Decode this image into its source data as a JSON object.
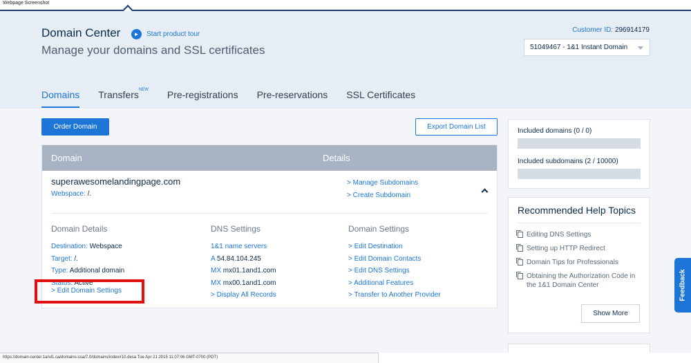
{
  "caption": "Webpage Screenshot",
  "header": {
    "title": "Domain Center",
    "tour_label": "Start product tour",
    "subtitle": "Manage your domains and SSL certificates",
    "customer_id_label": "Customer ID:",
    "customer_id": "296914179",
    "contract_select": "51049467 - 1&1 Instant Domain"
  },
  "tabs": [
    {
      "label": "Domains",
      "badge": ""
    },
    {
      "label": "Transfers",
      "badge": "NEW"
    },
    {
      "label": "Pre-registrations",
      "badge": ""
    },
    {
      "label": "Pre-reservations",
      "badge": ""
    },
    {
      "label": "SSL Certificates",
      "badge": ""
    }
  ],
  "toolbar": {
    "order_label": "Order Domain",
    "export_label": "Export Domain List"
  },
  "table": {
    "col_domain": "Domain",
    "col_details": "Details",
    "domain_name": "superawesomelandingpage.com",
    "webspace_label": "Webspace:",
    "webspace_value": "/.",
    "top_links": [
      "> Manage Subdomains",
      "> Create Subdomain"
    ],
    "details": {
      "heading": "Domain Details",
      "rows": [
        {
          "k": "Destination:",
          "v": "Webspace"
        },
        {
          "k": "Target:",
          "v": "/."
        },
        {
          "k": "Type:",
          "v": "Additional domain"
        },
        {
          "k": "Status:",
          "v": "Active"
        }
      ],
      "edit_label": "> Edit Domain Settings"
    },
    "dns": {
      "heading": "DNS Settings",
      "name_servers": "1&1 name servers",
      "rows": [
        {
          "k": "A",
          "v": "54.84.104.245"
        },
        {
          "k": "MX",
          "v": "mx01.1and1.com"
        },
        {
          "k": "MX",
          "v": "mx00.1and1.com"
        }
      ],
      "display_all": "> Display All Records"
    },
    "settings": {
      "heading": "Domain Settings",
      "links": [
        "> Edit Destination",
        "> Edit Domain Contacts",
        "> Edit DNS Settings",
        "> Additional Features",
        "> Transfer to Another Provider"
      ]
    }
  },
  "sidebar": {
    "included_domains": "Included domains (0 / 0)",
    "included_subdomains": "Included subdomains (2 / 10000)",
    "help_title": "Recommended Help Topics",
    "help_items": [
      "Editing DNS Settings",
      "Setting up HTTP Redirect",
      "Domain Tips for Professionals",
      "Obtaining the Authorization Code in the 1&1 Domain Center"
    ],
    "show_more": "Show More"
  },
  "feedback_label": "Feedback",
  "status_url": "https://domain-center.1and1.ca/domains-ssa/7.0/domains/index#10.desa Tue Apr 21 2015 11:07:06 GMT-0700 (PDT)",
  "colors": {
    "accent": "#1d75d8",
    "header_bg": "#e6edf4",
    "table_head": "#a7b3c2",
    "highlight": "#e01010"
  }
}
